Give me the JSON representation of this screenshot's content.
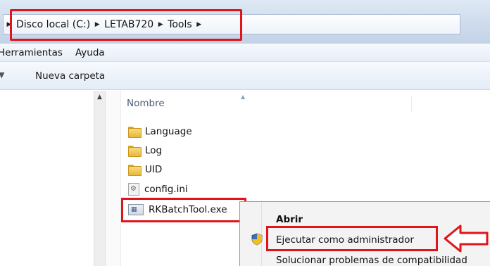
{
  "address_bar": {
    "crumbs": [
      "Disco local (C:)",
      "LETAB720",
      "Tools"
    ],
    "separator_icon": "chevron-right-icon"
  },
  "menu": {
    "items": [
      "Herramientas",
      "Ayuda"
    ]
  },
  "toolbar": {
    "new_folder_label": "Nueva carpeta"
  },
  "file_list": {
    "column_header": "Nombre",
    "items": [
      {
        "name": "Language",
        "icon": "folder-icon"
      },
      {
        "name": "Log",
        "icon": "folder-icon"
      },
      {
        "name": "UID",
        "icon": "folder-icon"
      },
      {
        "name": "config.ini",
        "icon": "settings-file-icon"
      },
      {
        "name": "RKBatchTool.exe",
        "icon": "executable-icon"
      }
    ]
  },
  "context_menu": {
    "items": [
      {
        "label": "Abrir",
        "default": true
      },
      {
        "label": "Ejecutar como administrador",
        "icon": "uac-shield-icon"
      },
      {
        "label": "Solucionar problemas de compatibilidad"
      }
    ]
  },
  "annotations": {
    "highlight_color": "#e0141b",
    "arrow": "left-arrow-callout"
  }
}
